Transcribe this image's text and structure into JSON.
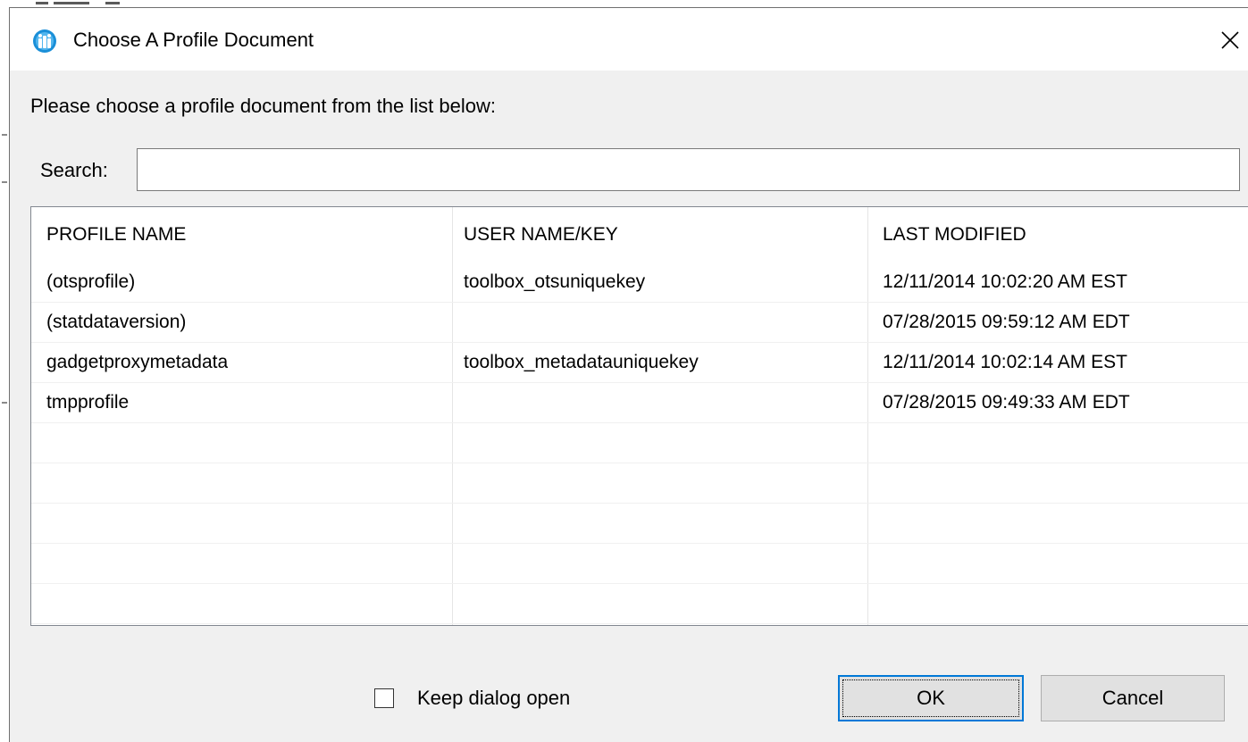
{
  "dialog": {
    "title": "Choose A Profile Document",
    "icon": "app-logo-icon",
    "close_icon": "close-icon"
  },
  "instruction": "Please choose a profile document from the list below:",
  "search": {
    "label": "Search:",
    "value": "",
    "placeholder": ""
  },
  "table": {
    "columns": [
      "PROFILE NAME",
      "USER NAME/KEY",
      "LAST MODIFIED"
    ],
    "rows": [
      [
        "(otsprofile)",
        "toolbox_otsuniquekey",
        "12/11/2014 10:02:20 AM EST"
      ],
      [
        "(statdataversion)",
        "",
        "07/28/2015 09:59:12 AM EDT"
      ],
      [
        "gadgetproxymetadata",
        "toolbox_metadatauniquekey",
        "12/11/2014 10:02:14 AM EST"
      ],
      [
        "tmpprofile",
        "",
        "07/28/2015 09:49:33 AM EDT"
      ]
    ]
  },
  "footer": {
    "keep_open_label": "Keep dialog open",
    "keep_open_checked": false,
    "ok_label": "OK",
    "cancel_label": "Cancel"
  },
  "colors": {
    "focus_border": "#0078d7",
    "titlebar_bg": "#ffffff",
    "dialog_bg": "#f0f0f0"
  }
}
